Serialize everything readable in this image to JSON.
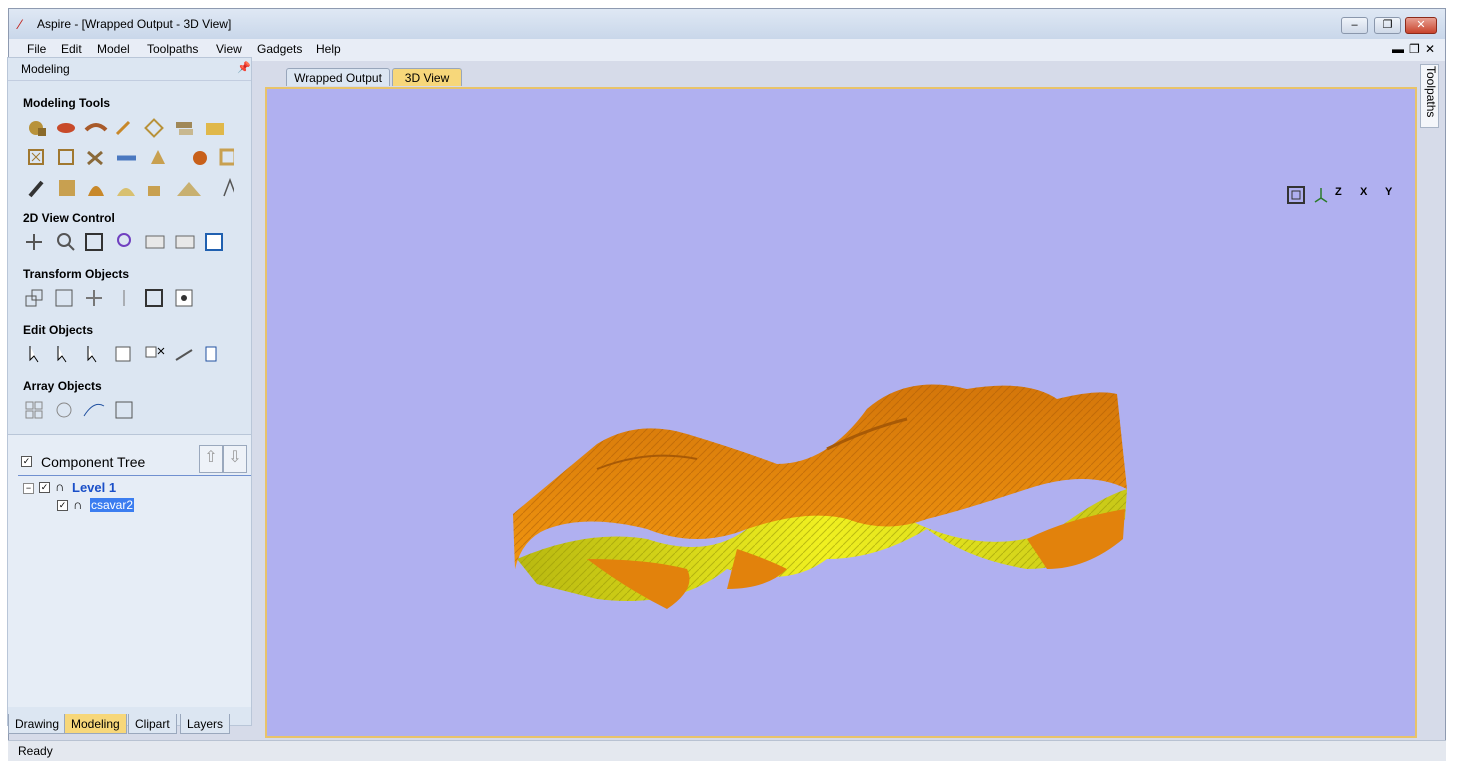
{
  "window": {
    "title": "Aspire - [Wrapped Output - 3D View]",
    "minimize": "–",
    "restore": "❐",
    "close": "✕"
  },
  "menu": [
    "File",
    "Edit",
    "Model",
    "Toolpaths",
    "View",
    "Gadgets",
    "Help"
  ],
  "mdi": {
    "minimize": "▬",
    "restore": "❐",
    "close": "✕"
  },
  "panel": {
    "title": "Modeling",
    "sections": {
      "modeling_tools": "Modeling Tools",
      "view_control": "2D View Control",
      "transform": "Transform Objects",
      "edit": "Edit Objects",
      "array": "Array Objects"
    }
  },
  "tree": {
    "title": "Component Tree",
    "level": "Level 1",
    "item": "csavar2"
  },
  "bottom_tabs": [
    "Drawing",
    "Modeling",
    "Clipart",
    "Layers"
  ],
  "doc_tabs": [
    "Wrapped Output",
    "3D View"
  ],
  "side_tab": "Toolpaths",
  "status": "Ready",
  "view_icons": [
    "fit-view",
    "iso",
    "Z",
    "X",
    "Y"
  ],
  "colors": {
    "viewport": "#b0b0f0",
    "model_orange": "#e8870f",
    "model_yellow": "#e5e51a",
    "accent_tab": "#f7d77a"
  }
}
